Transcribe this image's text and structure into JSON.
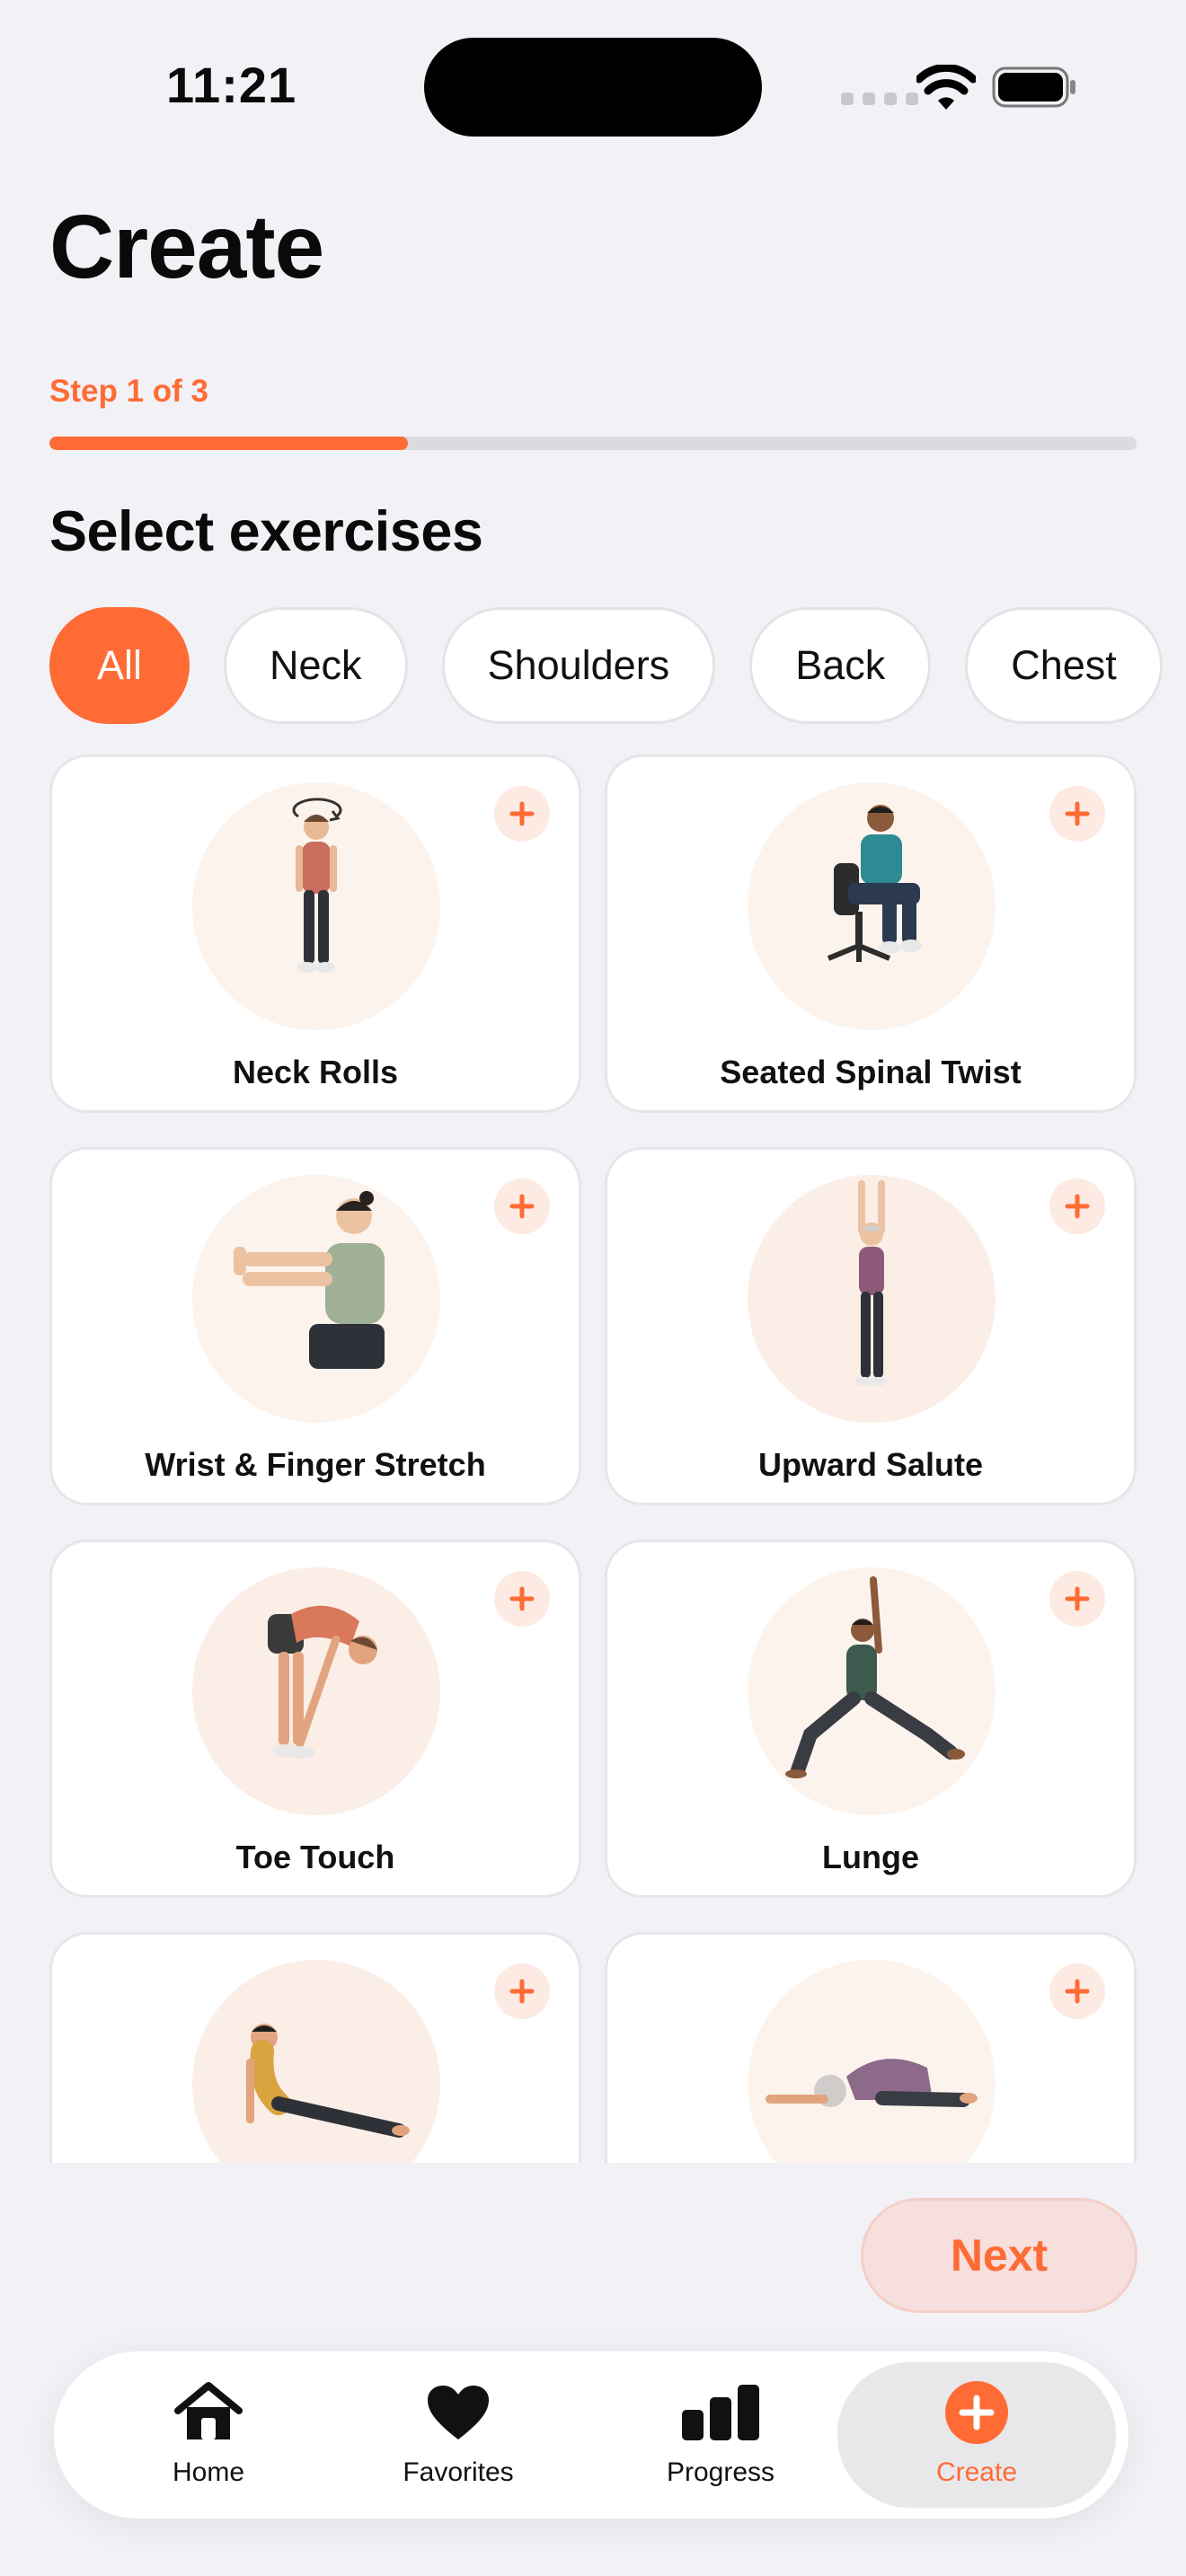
{
  "status_bar": {
    "time": "11:21"
  },
  "header": {
    "title": "Create",
    "step_label": "Step 1 of 3",
    "step_progress": 0.33
  },
  "section": {
    "title": "Select exercises"
  },
  "filters": [
    {
      "label": "All",
      "active": true
    },
    {
      "label": "Neck",
      "active": false
    },
    {
      "label": "Shoulders",
      "active": false
    },
    {
      "label": "Back",
      "active": false
    },
    {
      "label": "Chest",
      "active": false
    }
  ],
  "exercises": [
    {
      "name": "Neck Rolls",
      "icon": "neck-rolls-illustration"
    },
    {
      "name": "Seated Spinal Twist",
      "icon": "seated-twist-illustration"
    },
    {
      "name": "Wrist & Finger Stretch",
      "icon": "wrist-stretch-illustration"
    },
    {
      "name": "Upward Salute",
      "icon": "upward-salute-illustration"
    },
    {
      "name": "Toe Touch",
      "icon": "toe-touch-illustration"
    },
    {
      "name": "Lunge",
      "icon": "lunge-illustration"
    },
    {
      "name": "",
      "icon": "cobra-pose-illustration"
    },
    {
      "name": "",
      "icon": "childs-pose-illustration"
    }
  ],
  "actions": {
    "next_label": "Next"
  },
  "tab_bar": [
    {
      "label": "Home",
      "icon": "home-icon"
    },
    {
      "label": "Favorites",
      "icon": "heart-icon"
    },
    {
      "label": "Progress",
      "icon": "bar-chart-icon"
    },
    {
      "label": "Create",
      "icon": "plus-circle-icon",
      "active": true
    }
  ],
  "colors": {
    "accent": "#FF6B35",
    "background": "#F2F1F6",
    "chip_border": "#E3E3E8"
  }
}
